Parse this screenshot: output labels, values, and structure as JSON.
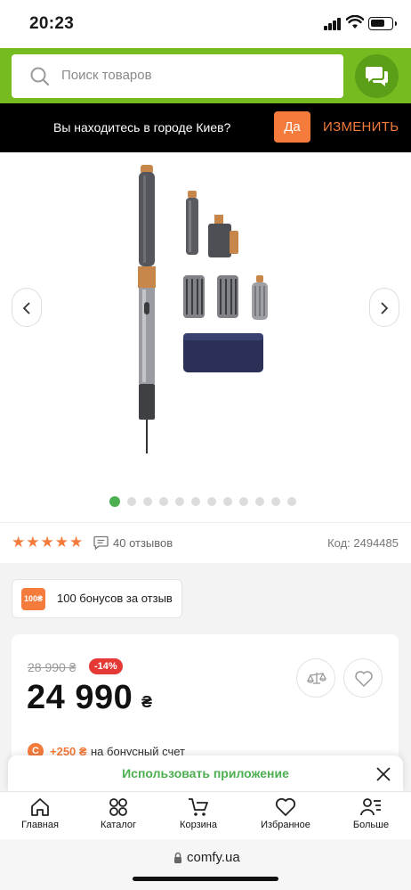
{
  "status_bar": {
    "time": "20:23",
    "battery_level": 0.7
  },
  "search": {
    "placeholder": "Поиск товаров"
  },
  "city_banner": {
    "question": "Вы находитесь в городе Киев?",
    "confirm_label": "Да",
    "change_label": "ИЗМЕНИТЬ"
  },
  "gallery": {
    "slide_count": 12,
    "active_slide": 1
  },
  "rating": {
    "stars": 5,
    "reviews": "40 отзывов",
    "code": "Код: 2494485"
  },
  "bonus_badge": {
    "tag": "100₴",
    "text": "100 бонусов за отзыв"
  },
  "price": {
    "old": "28 990 ₴",
    "discount": "-14%",
    "current": "24 990",
    "currency": "₴",
    "bonus_amount": "+250 ₴",
    "bonus_target": "на бонусный счет"
  },
  "app_banner": {
    "text": "Использовать приложение"
  },
  "bottom_nav": {
    "items": [
      {
        "label": "Главная",
        "icon": "home-icon"
      },
      {
        "label": "Каталог",
        "icon": "catalog-icon"
      },
      {
        "label": "Корзина",
        "icon": "cart-icon"
      },
      {
        "label": "Избранное",
        "icon": "heart-icon"
      },
      {
        "label": "Больше",
        "icon": "more-icon"
      }
    ]
  },
  "browser": {
    "url": "comfy.ua"
  },
  "colors": {
    "brand_green": "#76bc21",
    "accent_orange": "#f47b3c",
    "discount_red": "#e53935",
    "active_dot": "#4caf50"
  }
}
